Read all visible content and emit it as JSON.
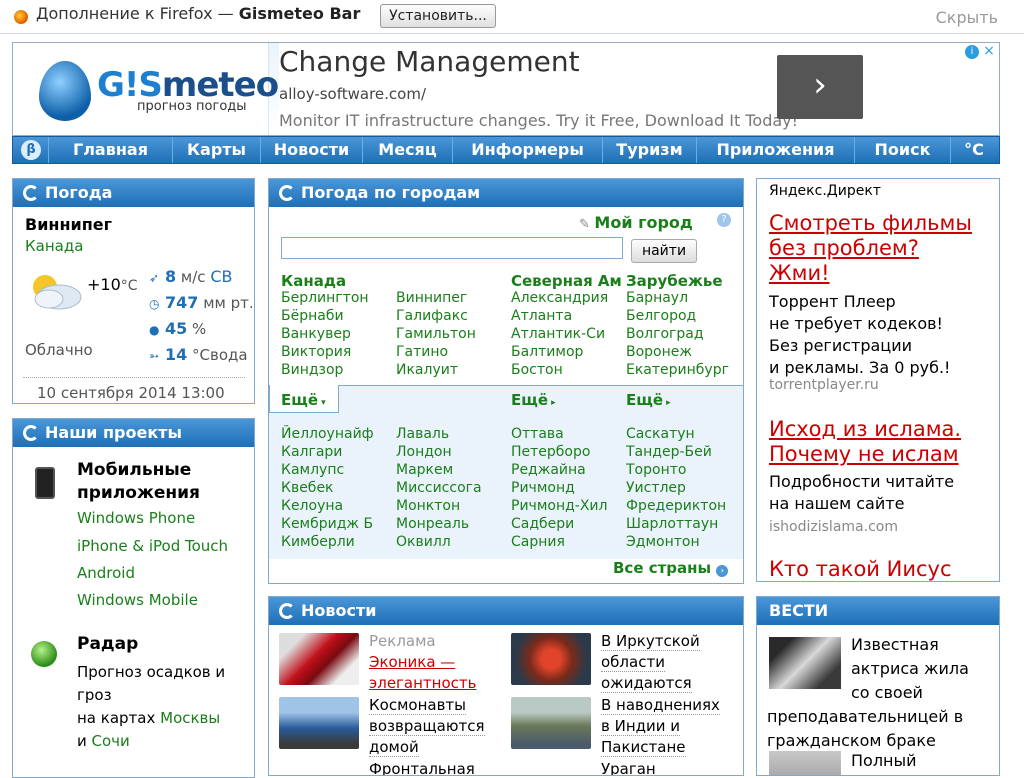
{
  "addon_bar": {
    "text_prefix": "Дополнение к Firefox — ",
    "addon_name": "Gismeteo Bar",
    "install_label": "Установить...",
    "hide_label": "Скрыть"
  },
  "header": {
    "logo_brand_a": "G!S",
    "logo_brand_b": "meteo",
    "logo_sub": "прогноз погоды",
    "ad": {
      "title": "Change Management",
      "url": "alloy-software.com/",
      "text": "Monitor IT infrastructure changes. Try it Free, Download It Today!",
      "arrow": "›",
      "info": "i",
      "close": "×"
    }
  },
  "nav": {
    "beta": "β",
    "items": [
      "Главная",
      "Карты",
      "Новости",
      "Месяц",
      "Информеры",
      "Туризм",
      "Приложения",
      "Поиск",
      "°С"
    ]
  },
  "weather": {
    "title": "Погода",
    "city": "Виннипег",
    "country": "Канада",
    "temp": "+10",
    "temp_unit": "°С",
    "description": "Облачно",
    "wind_value": "8",
    "wind_unit": "м/с",
    "wind_dir": "СВ",
    "pressure_value": "747",
    "pressure_unit": "мм рт.",
    "humidity_value": "45",
    "humidity_unit": "%",
    "water_value": "14",
    "water_unit": "°Свода",
    "date": "10 сентября 2014 13:00"
  },
  "projects": {
    "title": "Наши проекты",
    "mobile_title_1": "Мобильные",
    "mobile_title_2": "приложения",
    "mobile_links": [
      "Windows Phone",
      "iPhone & iPod Touch",
      "Android",
      "Windows Mobile"
    ],
    "radar_title": "Радар",
    "radar_text_1": "Прогноз осадков и",
    "radar_text_2": "гроз",
    "radar_text_3": "на картах ",
    "radar_link_1": "Москвы",
    "radar_text_4": "и ",
    "radar_link_2": "Сочи"
  },
  "cities": {
    "title": "Погода по городам",
    "my_city": "Мой город",
    "help": "?",
    "find_label": "найти",
    "col_heads": [
      "Канада",
      "",
      "Северная Ам",
      "Зарубежье"
    ],
    "cols": [
      [
        "Берлингтон",
        "Бёрнаби",
        "Ванкувер",
        "Виктория",
        "Виндзор"
      ],
      [
        "Виннипег",
        "Галифакс",
        "Гамильтон",
        "Гатино",
        "Икалуит"
      ],
      [
        "Александрия",
        "Атланта",
        "Атлантик-Си",
        "Балтимор",
        "Бостон"
      ],
      [
        "Барнаул",
        "Белгород",
        "Волгоград",
        "Воронеж",
        "Екатеринбург"
      ]
    ],
    "more_label": "Ещё",
    "more_cols": [
      [
        "Йеллоунайф",
        "Калгари",
        "Камлупс",
        "Квебек",
        "Келоуна",
        "Кембридж Б",
        "Кимберли"
      ],
      [
        "Лаваль",
        "Лондон",
        "Маркем",
        "Миссиссога",
        "Монктон",
        "Монреаль",
        "Оквилл"
      ],
      [
        "Оттава",
        "Петерборо",
        "Реджайна",
        "Ричмонд",
        "Ричмонд-Хил",
        "Садбери",
        "Сарния"
      ],
      [
        "Саскатун",
        "Тандер-Бей",
        "Торонто",
        "Уистлер",
        "Фредериктон",
        "Шарлоттаун",
        "Эдмонтон"
      ]
    ],
    "all_countries": "Все страны"
  },
  "news": {
    "title": "Новости",
    "items": [
      {
        "label": "Реклама",
        "l1": "Эконика —",
        "l2": "элегантность"
      },
      {
        "l1": "В Иркутской",
        "l2": "области",
        "l3": "ожидаются"
      },
      {
        "l1": "Космонавты",
        "l2": "возвращаются",
        "l3": "домой"
      },
      {
        "l1": "В наводнениях",
        "l2": "в Индии и",
        "l3": "Пакистане"
      },
      {
        "l1": "Фронтальная"
      },
      {
        "l1": "Ураган"
      }
    ]
  },
  "direct": {
    "title": "Яндекс.Директ",
    "ad1_link": [
      "Смотреть фильмы",
      "без проблем?",
      "Жми!"
    ],
    "ad1_text": [
      "Торрент Плеер",
      "не требует кодеков!",
      "Без регистрации",
      "и рекламы. За 0 руб.!"
    ],
    "ad1_url": "torrentplayer.ru",
    "ad2_link": [
      "Исход из ислама.",
      "Почему не ислам"
    ],
    "ad2_text": [
      "Подробности читайте",
      "на нашем сайте"
    ],
    "ad2_url": "ishodizislama.com",
    "ad3_link": "Кто такой Иисус"
  },
  "vesti": {
    "title": "ВЕСТИ",
    "item1": [
      "Известная",
      "актриса жила",
      "со своей",
      "преподавательницей в",
      "гражданском браке"
    ],
    "item2": "Полный"
  }
}
